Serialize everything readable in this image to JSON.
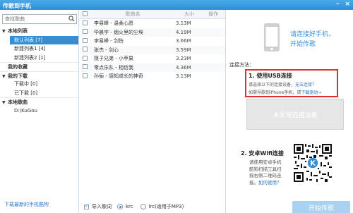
{
  "window": {
    "title": "传歌到手机"
  },
  "left": {
    "search_placeholder": "查找歌曲",
    "groups": [
      {
        "label": "本地列表",
        "items": [
          "默认列表 [7]",
          "新建列表1 [4]",
          "新建列表2 [1]"
        ]
      },
      {
        "label": "我的收藏",
        "items": []
      },
      {
        "label": "我的下载",
        "items": [
          "下载中 [0]",
          "已下载 [0]"
        ]
      },
      {
        "label": "本地歌曲",
        "items": [
          "D:\\KuGou"
        ]
      }
    ],
    "bottom_link": "下载最新的手机酷狗"
  },
  "table": {
    "headers": {
      "name": "歌曲名",
      "size": "大小",
      "action": "操作"
    },
    "rows": [
      {
        "name": "李易峰 - 温柔心愿",
        "size": "3.13M"
      },
      {
        "name": "华晨宇 - 烟火里的尘埃",
        "size": "4.19M"
      },
      {
        "name": "李易峰 - 剑伤",
        "size": "3.66M"
      },
      {
        "name": "张杰 - 剑心",
        "size": "3.59M"
      },
      {
        "name": "筷子兄弟 - 小苹果",
        "size": "3.23M"
      },
      {
        "name": "零点乐队 - 相信我",
        "size": "4.36M"
      },
      {
        "name": "孙俪 - 感知成长的神奇",
        "size": "3.13M"
      }
    ],
    "bottom": {
      "import_lyrics": "导入歌词",
      "opt_krc": "krc",
      "opt_lrc": "lrc(适用于MP3)"
    }
  },
  "right": {
    "connect_tip_line1": "请连接好手机，",
    "connect_tip_line2": "开始传歌",
    "method_label": "连接方法：",
    "usb": {
      "heading": "1. 使用USB连接",
      "line1_text": "请选择以下的连接设备，",
      "line1_link": "无法连接？",
      "line2_text": "如需导歌到iPhone手机，请",
      "line2_link": "下载驱动→"
    },
    "no_device_button": "未发现连接设备",
    "wifi": {
      "heading": "2. 安卓Wifi连接",
      "line1": "请使用安卓手机",
      "line2": "酷狗扫描工具扫",
      "line3": "描右侧二维码连",
      "line4_text": "接。",
      "line4_link": "如何使用？"
    },
    "start_button": "开始传歌"
  }
}
